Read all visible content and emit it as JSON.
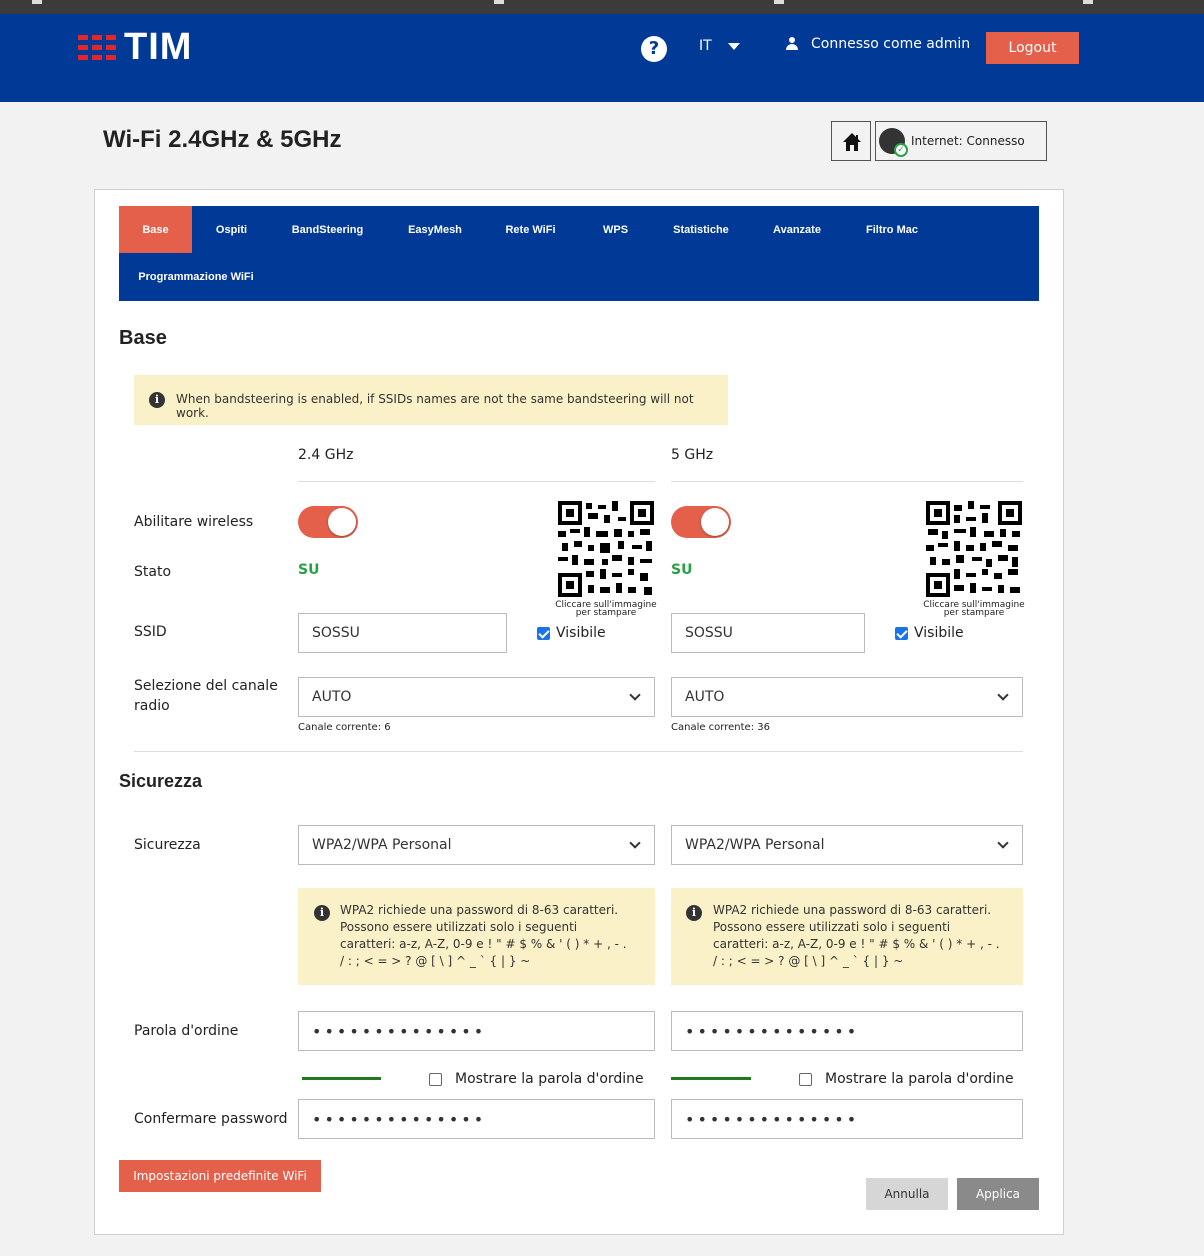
{
  "header": {
    "logo_text": "TIM",
    "help_label": "?",
    "language": "IT",
    "user_label": "Connesso come admin",
    "logout_label": "Logout"
  },
  "page": {
    "title": "Wi-Fi 2.4GHz & 5GHz",
    "internet_status": "Internet: Connesso"
  },
  "tabs": [
    {
      "label": "Base",
      "active": true
    },
    {
      "label": "Ospiti"
    },
    {
      "label": "BandSteering"
    },
    {
      "label": "EasyMesh"
    },
    {
      "label": "Rete WiFi"
    },
    {
      "label": "WPS"
    },
    {
      "label": "Statistiche"
    },
    {
      "label": "Avanzate"
    },
    {
      "label": "Filtro Mac"
    },
    {
      "label": "Programmazione WiFi"
    }
  ],
  "base": {
    "heading": "Base",
    "notice": "When bandsteering is enabled, if SSIDs names are not the same bandsteering will not work.",
    "bands": [
      {
        "name": "2.4 GHz",
        "wireless_enabled": true,
        "status": "SU",
        "qr_caption_1": "Cliccare sull'immagine",
        "qr_caption_2": "per stampare",
        "ssid": "SOSSU",
        "visible": true,
        "visible_label": "Visibile",
        "channel_selection": "AUTO",
        "current_channel": "Canale corrente: 6"
      },
      {
        "name": "5 GHz",
        "wireless_enabled": true,
        "status": "SU",
        "qr_caption_1": "Cliccare sull'immagine",
        "qr_caption_2": "per stampare",
        "ssid": "SOSSU",
        "visible": true,
        "visible_label": "Visibile",
        "channel_selection": "AUTO",
        "current_channel": "Canale corrente: 36"
      }
    ],
    "labels": {
      "enable_wireless": "Abilitare wireless",
      "status": "Stato",
      "ssid": "SSID",
      "channel_1": "Selezione del canale",
      "channel_2": "radio"
    }
  },
  "security": {
    "heading": "Sicurezza",
    "labels": {
      "security": "Sicurezza",
      "password": "Parola d'ordine",
      "confirm_password": "Confermare password"
    },
    "bands": [
      {
        "mode": "WPA2/WPA Personal",
        "notice": "WPA2 richiede una password di 8-63 caratteri. Possono essere utilizzati solo i seguenti caratteri: a-z, A-Z, 0-9 e ! \" # $ % & ' ( ) * + , - . / : ; < = > ? @ [ \\ ] ^ _ ` { | } ~",
        "password_mask": "••••••••••••••",
        "confirm_mask": "••••••••••••••",
        "show_password_label": "Mostrare la parola d'ordine",
        "show_password": false
      },
      {
        "mode": "WPA2/WPA Personal",
        "notice": "WPA2 richiede una password di 8-63 caratteri. Possono essere utilizzati solo i seguenti caratteri: a-z, A-Z, 0-9 e ! \" # $ % & ' ( ) * + , - . / : ; < = > ? @ [ \\ ] ^ _ ` { | } ~",
        "password_mask": "••••••••••••••",
        "confirm_mask": "••••••••••••••",
        "show_password_label": "Mostrare la parola d'ordine",
        "show_password": false
      }
    ]
  },
  "actions": {
    "defaults_label": "Impostazioni predefinite WiFi",
    "cancel_label": "Annulla",
    "apply_label": "Applica"
  },
  "colors": {
    "brand_blue": "#003a96",
    "accent_orange": "#e4604b",
    "status_green": "#2aa046",
    "notice_bg": "#fbf1c8"
  }
}
